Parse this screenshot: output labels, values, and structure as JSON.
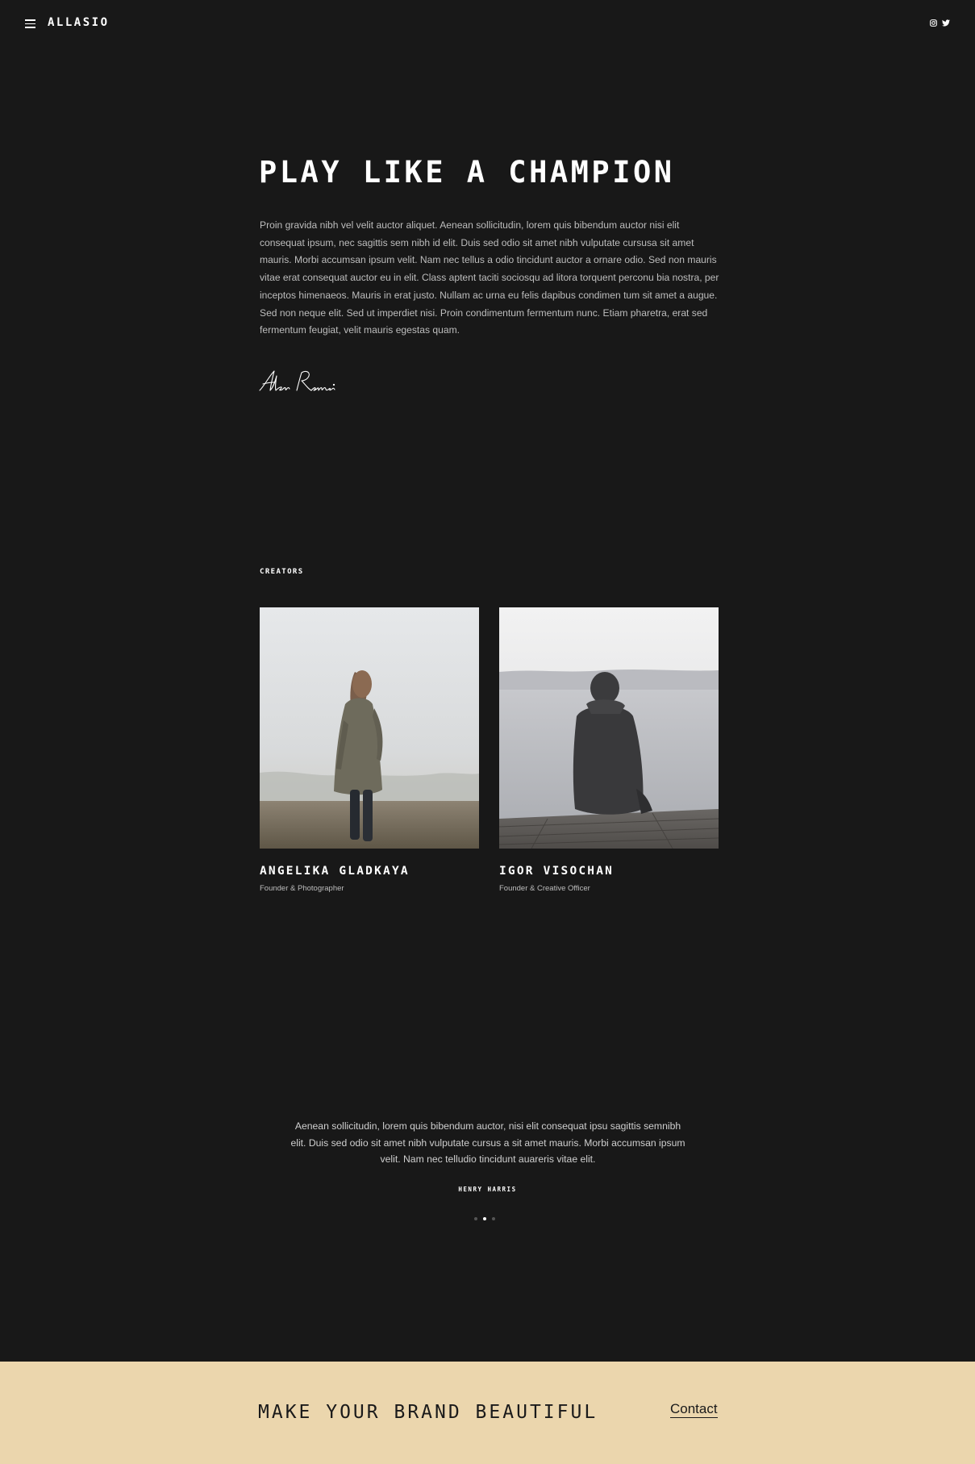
{
  "header": {
    "logo": "ALLASIO",
    "menu_icon": "hamburger-menu-icon",
    "social_icons": [
      "instagram-icon",
      "twitter-icon"
    ]
  },
  "hero": {
    "title": "PLAY LIKE A CHAMPION",
    "body": "Proin gravida nibh vel velit auctor aliquet. Aenean sollicitudin, lorem quis bibendum auctor nisi elit consequat ipsum, nec sagittis sem nibh id elit. Duis sed odio sit amet nibh vulputate cursusa sit amet mauris. Morbi accumsan ipsum velit. Nam nec tellus a odio tincidunt auctor a ornare odio. Sed non mauris vitae erat consequat auctor eu in elit. Class aptent taciti sociosqu ad litora torquent perconu bia nostra, per inceptos himenaeos. Mauris in erat justo. Nullam ac urna eu felis dapibus condimen tum sit amet a augue. Sed non neque elit. Sed ut imperdiet nisi. Proin condimentum fermentum nunc. Etiam pharetra, erat sed fermentum feugiat, velit mauris egestas quam.",
    "signature": "Alen Remsi"
  },
  "creators": {
    "label": "CREATORS",
    "people": [
      {
        "name": "ANGELIKA GLADKAYA",
        "role": "Founder & Photographer"
      },
      {
        "name": "IGOR VISOCHAN",
        "role": "Founder & Creative Officer"
      }
    ]
  },
  "testimonial": {
    "text": "Aenean sollicitudin, lorem quis bibendum auctor, nisi elit consequat ipsu sagittis semnibh elit. Duis sed odio sit amet nibh vulputate cursus a sit amet mauris. Morbi accumsan ipsum velit. Nam nec telludio tincidunt auareris vitae elit.",
    "author": "HENRY HARRIS",
    "slides": 3,
    "active_slide": 2
  },
  "footer": {
    "title": "MAKE YOUR BRAND BEAUTIFUL",
    "contact_label": "Contact",
    "background_color": "#ebd6ad"
  },
  "colors": {
    "background": "#181818",
    "text": "#ffffff",
    "muted_text": "#bdbdbd"
  }
}
